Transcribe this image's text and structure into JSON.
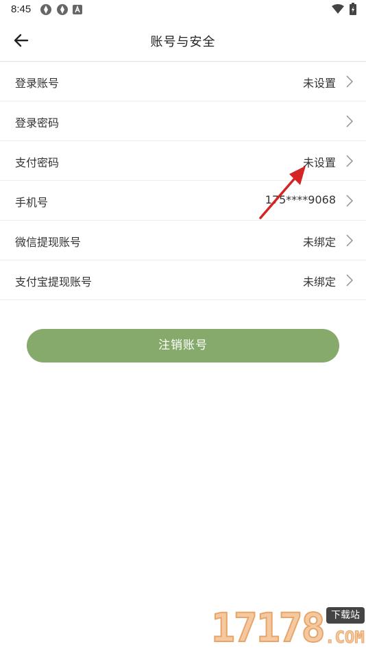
{
  "status_bar": {
    "time": "8:45"
  },
  "header": {
    "title": "账号与安全"
  },
  "rows": [
    {
      "label": "登录账号",
      "value": "未设置"
    },
    {
      "label": "登录密码",
      "value": ""
    },
    {
      "label": "支付密码",
      "value": "未设置"
    },
    {
      "label": "手机号",
      "value": "175****9068"
    },
    {
      "label": "微信提现账号",
      "value": "未绑定"
    },
    {
      "label": "支付宝提现账号",
      "value": "未绑定"
    }
  ],
  "logout_button": {
    "label": "注销账号",
    "color": "#86a96c"
  },
  "annotation": {
    "color": "#d42424"
  },
  "watermark": {
    "number": "17178",
    "badge": "下载站",
    "suffix": ".COM"
  }
}
